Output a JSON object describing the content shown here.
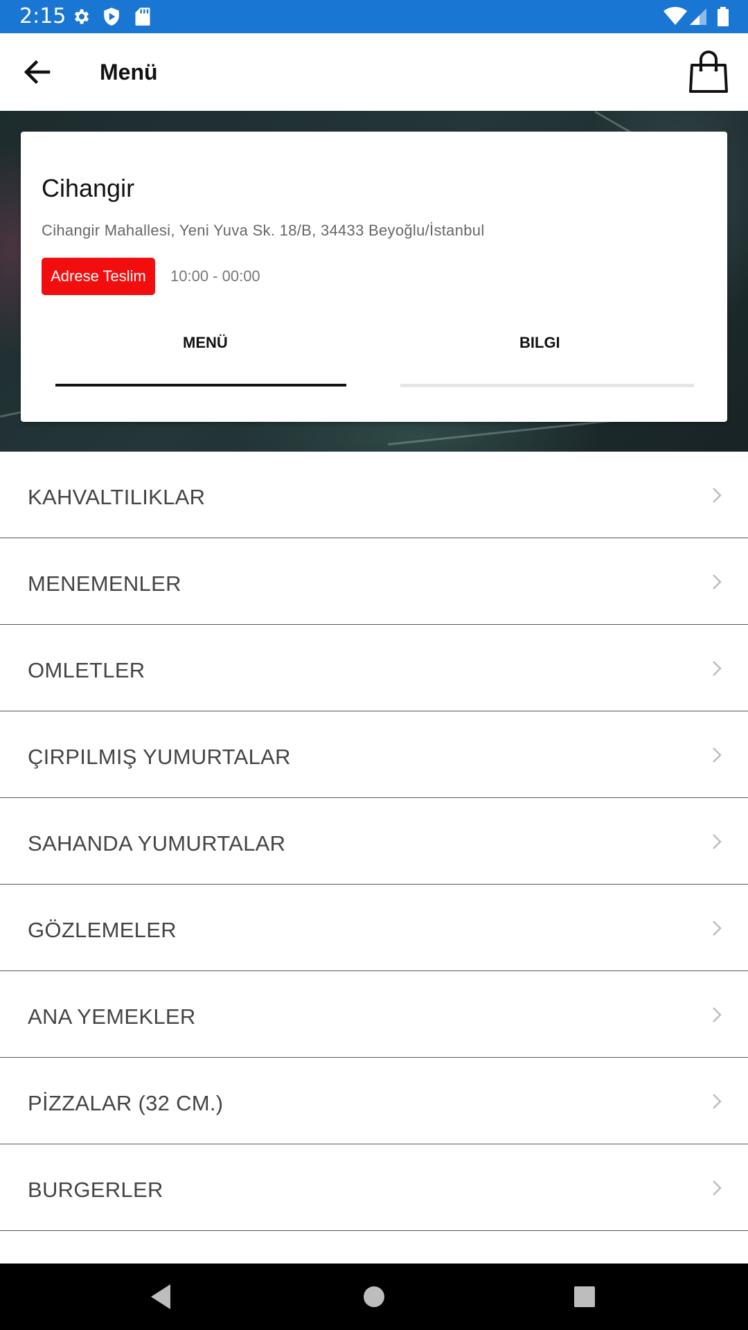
{
  "status_bar": {
    "time": "2:15",
    "left_icons": [
      "settings-icon",
      "shield-play-icon",
      "sd-card-icon"
    ],
    "right_icons": [
      "wifi-icon",
      "signal-icon",
      "battery-icon"
    ]
  },
  "app_bar": {
    "title": "Menü",
    "back_icon": "arrow-left-icon",
    "cart_icon": "shopping-bag-icon"
  },
  "restaurant": {
    "name": "Cihangir",
    "address": "Cihangir Mahallesi, Yeni Yuva Sk. 18/B, 34433 Beyoğlu/İstanbul",
    "delivery_badge": "Adrese Teslim",
    "badge_color": "#f20e0e",
    "hours": "10:00 - 00:00"
  },
  "tabs": [
    {
      "label": "MENÜ",
      "active": true
    },
    {
      "label": "BILGI",
      "active": false
    }
  ],
  "categories": [
    "KAHVALTILIKLAR",
    "MENEMENLER",
    "OMLETLER",
    "ÇIRPILMIŞ YUMURTALAR",
    "SAHANDA YUMURTALAR",
    "GÖZLEMELER",
    "ANA YEMEKLER",
    "PİZZALAR (32 CM.)",
    "BURGERLER"
  ],
  "nav_bar": {
    "buttons": [
      "back-triangle-icon",
      "home-circle-icon",
      "recents-square-icon"
    ]
  },
  "colors": {
    "status_bar": "#1976d2",
    "text_primary": "#111111",
    "category_text": "#444444"
  }
}
